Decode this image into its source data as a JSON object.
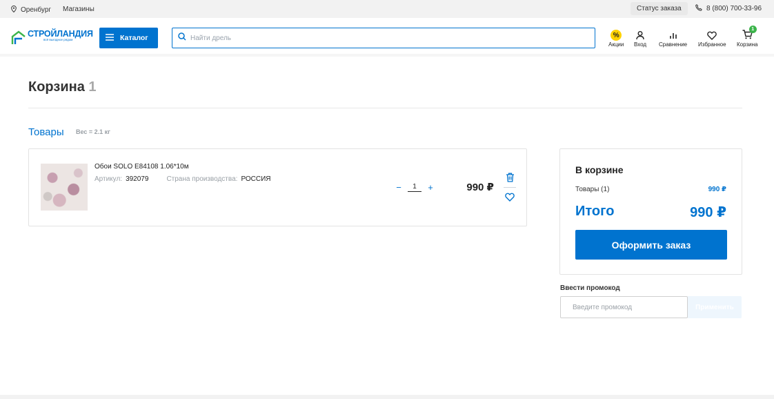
{
  "topbar": {
    "city": "Оренбург",
    "shops_label": "Магазины",
    "order_status_label": "Статус заказа",
    "phone": "8 (800) 700-33-96"
  },
  "header": {
    "logo_text": "СТРОЙЛАНДИЯ",
    "logo_tagline": "всё выгодное рядом",
    "catalog_label": "Каталог",
    "search_placeholder": "Найти дрель",
    "icons": {
      "sales": "Акции",
      "login": "Вход",
      "compare": "Сравнение",
      "favorites": "Избранное",
      "cart": "Корзина"
    },
    "cart_count": "1"
  },
  "page": {
    "title": "Корзина",
    "title_count": "1",
    "section_title": "Товары",
    "weight": "Вес = 2.1 кг"
  },
  "product": {
    "name": "Обои SOLO E84108 1.06*10м",
    "article_label": "Артикул:",
    "article": "392079",
    "country_label": "Страна производства:",
    "country": "РОССИЯ",
    "qty_minus": "−",
    "qty": "1",
    "qty_plus": "+",
    "price": "990 ₽"
  },
  "summary": {
    "title": "В корзине",
    "items_label": "Товары (1)",
    "items_price": "990 ₽",
    "total_label": "Итого",
    "total_price": "990 ₽",
    "order_button": "Оформить заказ"
  },
  "promo": {
    "label": "Ввести промокод",
    "placeholder": "Введите промокод",
    "apply_button": "Применить"
  },
  "colors": {
    "brand": "#0073cf",
    "sale_badge": "#ffd200",
    "cart_badge": "#3cb44b"
  }
}
